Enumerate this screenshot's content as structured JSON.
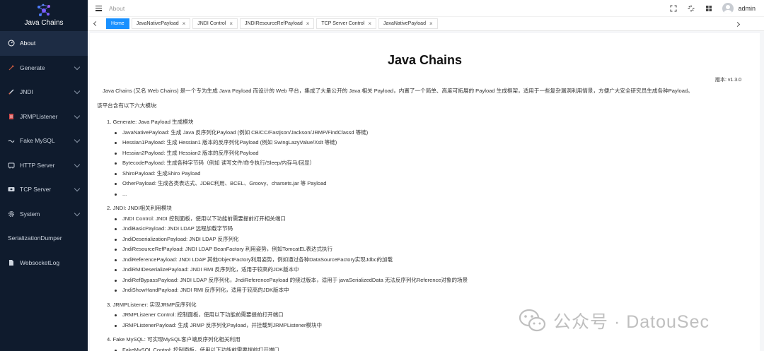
{
  "app": {
    "title": "Java Chains"
  },
  "sidebar": {
    "items": [
      {
        "label": "About",
        "icon": "gauge-icon",
        "active": true,
        "expandable": false
      },
      {
        "label": "Generate",
        "icon": "tool-icon",
        "active": false,
        "expandable": true
      },
      {
        "label": "JNDI",
        "icon": "pen-icon",
        "active": false,
        "expandable": true
      },
      {
        "label": "JRMPListener",
        "icon": "document-icon",
        "active": false,
        "expandable": true
      },
      {
        "label": "Fake MySQL",
        "icon": "database-icon",
        "active": false,
        "expandable": true
      },
      {
        "label": "HTTP Server",
        "icon": "server-icon",
        "active": false,
        "expandable": true
      },
      {
        "label": "TCP Server",
        "icon": "network-icon",
        "active": false,
        "expandable": true
      },
      {
        "label": "System",
        "icon": "gear-icon",
        "active": false,
        "expandable": true
      },
      {
        "label": "SerializationDumper",
        "icon": "",
        "active": false,
        "expandable": false
      },
      {
        "label": "WebsocketLog",
        "icon": "file-icon",
        "active": false,
        "expandable": false
      }
    ]
  },
  "header": {
    "breadcrumb": "About",
    "username": "admin"
  },
  "tabs": [
    {
      "label": "Home",
      "active": true,
      "closable": false
    },
    {
      "label": "JavaNativePayload",
      "active": false,
      "closable": true
    },
    {
      "label": "JNDI Control",
      "active": false,
      "closable": true
    },
    {
      "label": "JNDIResourceRefPayload",
      "active": false,
      "closable": true
    },
    {
      "label": "TCP Server Control",
      "active": false,
      "closable": true
    },
    {
      "label": "JavaNativePayload",
      "active": false,
      "closable": true
    }
  ],
  "doc": {
    "title": "Java Chains",
    "version": "版本: v1.3.0",
    "intro": "Java Chains (又名 Web Chains) 是一个专为生成 Java Payload 而设计的 Web 平台，集成了大量公开的 Java 相关 Payload，内置了一个简单、高度可拓展的 Payload 生成框架，适用于一些复杂漏洞利用情景，方便广大安全研究员生成各种Payload。",
    "subheading": "该平台含有以下六大模块:",
    "sections": [
      {
        "title": "1. Generate: Java Payload 生成模块",
        "items": [
          "JavaNativePayload: 生成 Java 反序列化Payload (例如 CB/CC/Fastjson/Jackson/JRMP/FindClassd 等链)",
          "Hessian1Payload: 生成 Hessian1 版本的反序列化Payload (例如 SwingLazyValue/Xslt 等链)",
          "Hessian2Payload: 生成 Hessian2 版本的反序列化Payload",
          "BytecodePayload: 生成各种字节码（例如 读写文件/命令执行/Sleep/内存马/回显）",
          "ShiroPayload: 生成Shiro Payload",
          "OtherPayload: 生成各类表达式、JDBC利用、BCEL、Groovy、charsets.jar 等 Payload",
          "..."
        ]
      },
      {
        "title": "2. JNDI: JNDI相关利用模块",
        "items": [
          "JNDI Control: JNDI 控制面板，使用以下功能前需要提前打开相关端口",
          "JndiBasicPayload: JNDI LDAP 远程加载字节码",
          "JndiDeserializationPayload: JNDI LDAP 反序列化",
          "JndiResourceRefPayload: JNDI LDAP BeanFactory 利用姿势，例如TomcatEL表达式执行",
          "JndiReferencePayload: JNDI LDAP 其他ObjectFactory利用姿势，例如通过各种DataSourceFactory实现Jdbc的加载",
          "JndiRMIDeserializePayload: JNDI RMI 反序列化，适用于较高的JDK版本中",
          "JndiRefBypassPayload: JNDI LDAP 反序列化，JndiReferencePayload 的绕过版本，适用于 javaSerializedData 无法反序列化Reference对象的场景",
          "JndiShowHandPayload: JNDI RMI 反序列化，适用于较高的JDK版本中"
        ]
      },
      {
        "title": "3. JRMPListener: 实现JRMP反序列化",
        "items": [
          "JRMPListener Control: 控制面板，使用以下功能前需要提前打开端口",
          "JRMPListenerPayload: 生成 JRMP 反序列化Payload，并挂载到JRMPListener模块中"
        ]
      },
      {
        "title": "4. Fake MySQL: 可实现MySQL客户端反序列化相关利用",
        "items": [
          "FakeMySQL Control: 控制面板，使用以下功能前需要提前打开端口"
        ]
      }
    ]
  },
  "watermark": {
    "text": "公众号 · DatouSec"
  },
  "colors": {
    "sidebar_bg": "#0f1b2d",
    "accent": "#1890ff"
  }
}
